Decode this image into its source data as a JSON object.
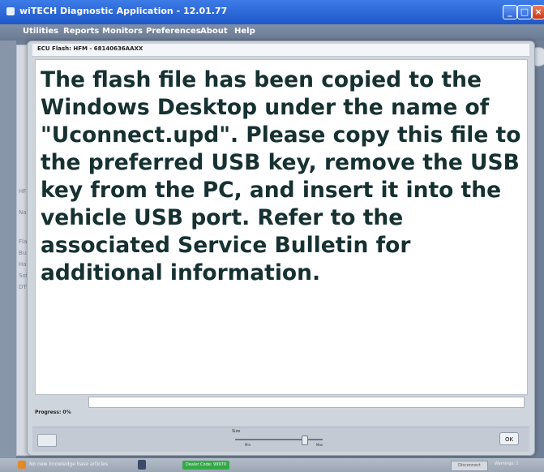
{
  "window": {
    "title": "wiTECH Diagnostic Application - 12.01.77"
  },
  "menu": {
    "items": [
      "Utilities",
      "Reports",
      "Monitors",
      "Preferences",
      "About",
      "Help"
    ]
  },
  "background": {
    "labels": [
      "HF",
      "Nam",
      "Flas",
      "Bus",
      "Harc",
      "Soft",
      "DTC"
    ]
  },
  "dialog": {
    "title": "ECU Flash: HFM - 68140636AAXX",
    "message": "The flash file has been copied to the Windows Desktop under the name of \"Uconnect.upd\". Please copy this file to the preferred USB key, remove the USB key from the PC, and insert it into the vehicle USB port. Refer to the associated Service Bulletin for additional information.",
    "progress_label": "Progress: 0%",
    "progress_value": 0,
    "size_label": "Size",
    "slider_min_label": "Min",
    "slider_max_label": "Max",
    "slider_level": 0.8,
    "ok_label": "OK"
  },
  "status": {
    "left_text": "No new knowledge base articles",
    "badge_text": "Dealer Code: 99970",
    "disconnect_label": "Disconnect",
    "warnings_text": "Warnings: 1"
  },
  "colors": {
    "titlebar": "#1f58c9",
    "message_text": "#163131",
    "progress": "#3aa94a",
    "status_badge": "#35a94a"
  }
}
